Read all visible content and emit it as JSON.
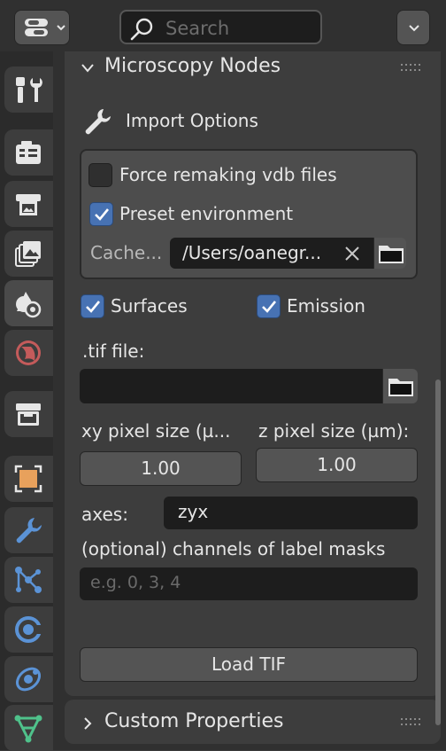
{
  "header": {
    "search_placeholder": "Search"
  },
  "tabs": [
    {
      "name": "tool-tab",
      "icon": "tool-icon"
    },
    {
      "name": "render-tab",
      "icon": "render-camera-icon"
    },
    {
      "name": "output-tab",
      "icon": "output-printer-icon"
    },
    {
      "name": "view-layer-tab",
      "icon": "view-layer-icon"
    },
    {
      "name": "scene-tab",
      "icon": "scene-icon"
    },
    {
      "name": "world-tab",
      "icon": "world-icon"
    },
    {
      "name": "collection-tab",
      "icon": "collection-box-icon"
    },
    {
      "name": "object-tab",
      "icon": "object-square-icon"
    },
    {
      "name": "modifiers-tab",
      "icon": "wrench-icon"
    },
    {
      "name": "particles-tab",
      "icon": "particles-icon"
    },
    {
      "name": "physics-tab",
      "icon": "physics-icon"
    },
    {
      "name": "constraints-tab",
      "icon": "constraints-icon"
    },
    {
      "name": "data-tab",
      "icon": "mesh-data-icon"
    }
  ],
  "panel": {
    "title": "Microscopy Nodes",
    "import_options": {
      "title": "Import Options",
      "force_remake_label": "Force remaking vdb files",
      "force_remake_checked": false,
      "preset_env_label": "Preset environment",
      "preset_env_checked": true,
      "cache_label": "Cache...",
      "cache_path": "/Users/oanegr..."
    },
    "surfaces_label": "Surfaces",
    "surfaces_checked": true,
    "emission_label": "Emission",
    "emission_checked": true,
    "tif_label": ".tif file:",
    "tif_value": "",
    "xy_label": "xy pixel size (µ...",
    "xy_value": "1.00",
    "z_label": "z pixel size (µm):",
    "z_value": "1.00",
    "axes_label": "axes:",
    "axes_value": "zyx",
    "label_masks_label": "(optional) channels of label masks",
    "label_masks_placeholder": "e.g. 0, 3, 4",
    "load_button": "Load TIF"
  },
  "custom_properties": {
    "title": "Custom Properties"
  },
  "colors": {
    "accent_checkbox": "#4772b3",
    "field_bg": "#1d1d1d",
    "panel_bg": "#3d3d3d"
  }
}
